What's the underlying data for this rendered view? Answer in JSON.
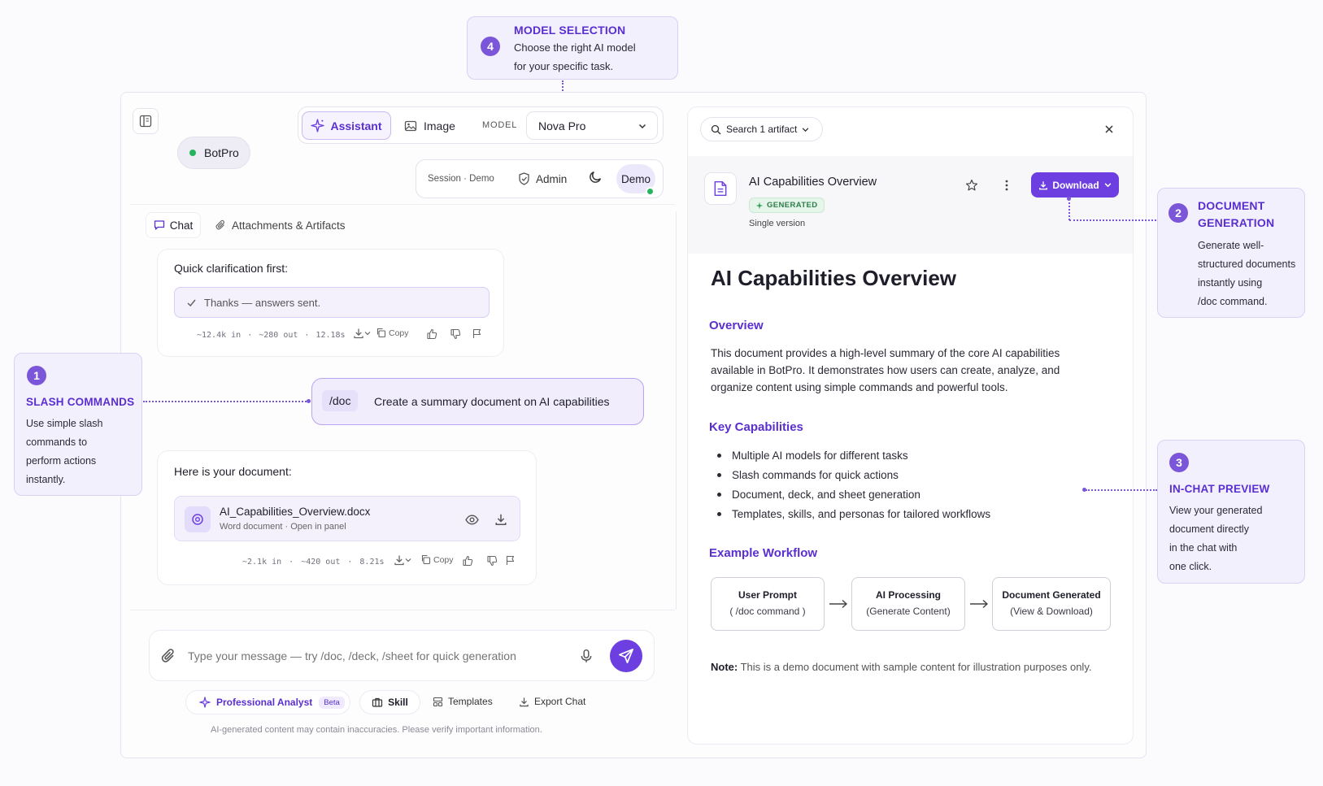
{
  "callouts": {
    "model": {
      "num": "4",
      "title": "MODEL SELECTION",
      "desc1": "Choose the right AI model",
      "desc2": "for your specific task."
    },
    "document": {
      "num": "2",
      "title1": "DOCUMENT",
      "title2": "GENERATION",
      "desc": [
        "Generate well-",
        "structured documents",
        "instantly using",
        "/doc command."
      ]
    },
    "slash": {
      "num": "1",
      "title": "SLASH COMMANDS",
      "desc": [
        "Use simple slash",
        "commands to",
        "perform actions",
        "instantly."
      ]
    },
    "preview": {
      "num": "3",
      "title": "IN-CHAT PREVIEW",
      "desc": [
        "View your generated",
        "document directly",
        "in the chat with",
        "one click."
      ]
    }
  },
  "header": {
    "mode_assistant": "Assistant",
    "mode_image": "Image",
    "model_label": "MODEL",
    "model_value": "Nova Pro",
    "workspace": "BotPro",
    "session": "Session · Demo",
    "admin": "Admin",
    "demo": "Demo"
  },
  "tabs": {
    "chat": "Chat",
    "attachments": "Attachments & Artifacts"
  },
  "messages": {
    "m1": {
      "title": "Quick clarification first:",
      "answered": "Thanks — answers sent.",
      "meta": {
        "in": "~12.4k in",
        "out": "~280 out",
        "time": "12.18s",
        "copy": "Copy"
      }
    },
    "user": {
      "command": "/doc",
      "text": "Create a summary document on AI capabilities"
    },
    "m2": {
      "title": "Here is your document:",
      "file_name": "AI_Capabilities_Overview.docx",
      "file_meta": "Word document · Open in panel",
      "meta": {
        "in": "~2.1k in",
        "out": "~420 out",
        "time": "8.21s",
        "copy": "Copy"
      }
    }
  },
  "composer": {
    "placeholder": "Type your message — try /doc, /deck, /sheet for quick generation",
    "persona": "Professional Analyst",
    "persona_badge": "Beta",
    "skill": "Skill",
    "templates": "Templates",
    "export": "Export Chat",
    "disclaimer": "AI-generated content may contain inaccuracies. Please verify important information."
  },
  "panel": {
    "search": "Search 1 artifact",
    "doc_title": "AI Capabilities Overview",
    "status": "GENERATED",
    "version": "Single version",
    "download": "Download"
  },
  "document": {
    "title": "AI Capabilities Overview",
    "overview_heading": "Overview",
    "overview_lines": [
      "This document provides a high-level summary of the core AI capabilities",
      "available in BotPro. It demonstrates how users can create, analyze, and",
      "organize content using simple commands and powerful tools."
    ],
    "capabilities_heading": "Key Capabilities",
    "capabilities": [
      "Multiple AI models for different tasks",
      "Slash commands for quick actions",
      "Document, deck, and sheet generation",
      "Templates, skills, and personas for tailored workflows"
    ],
    "workflow_heading": "Example Workflow",
    "workflow": [
      {
        "title": "User Prompt",
        "sub": "( /doc command )"
      },
      {
        "title": "AI Processing",
        "sub": "(Generate Content)"
      },
      {
        "title": "Document Generated",
        "sub": "(View & Download)"
      }
    ],
    "note_label": "Note:",
    "note_text": "This is a demo document with sample content for illustration purposes only."
  },
  "colors": {
    "accent": "#6d3fe0",
    "accent_light": "#f3f0fd",
    "success": "#22b55e"
  }
}
